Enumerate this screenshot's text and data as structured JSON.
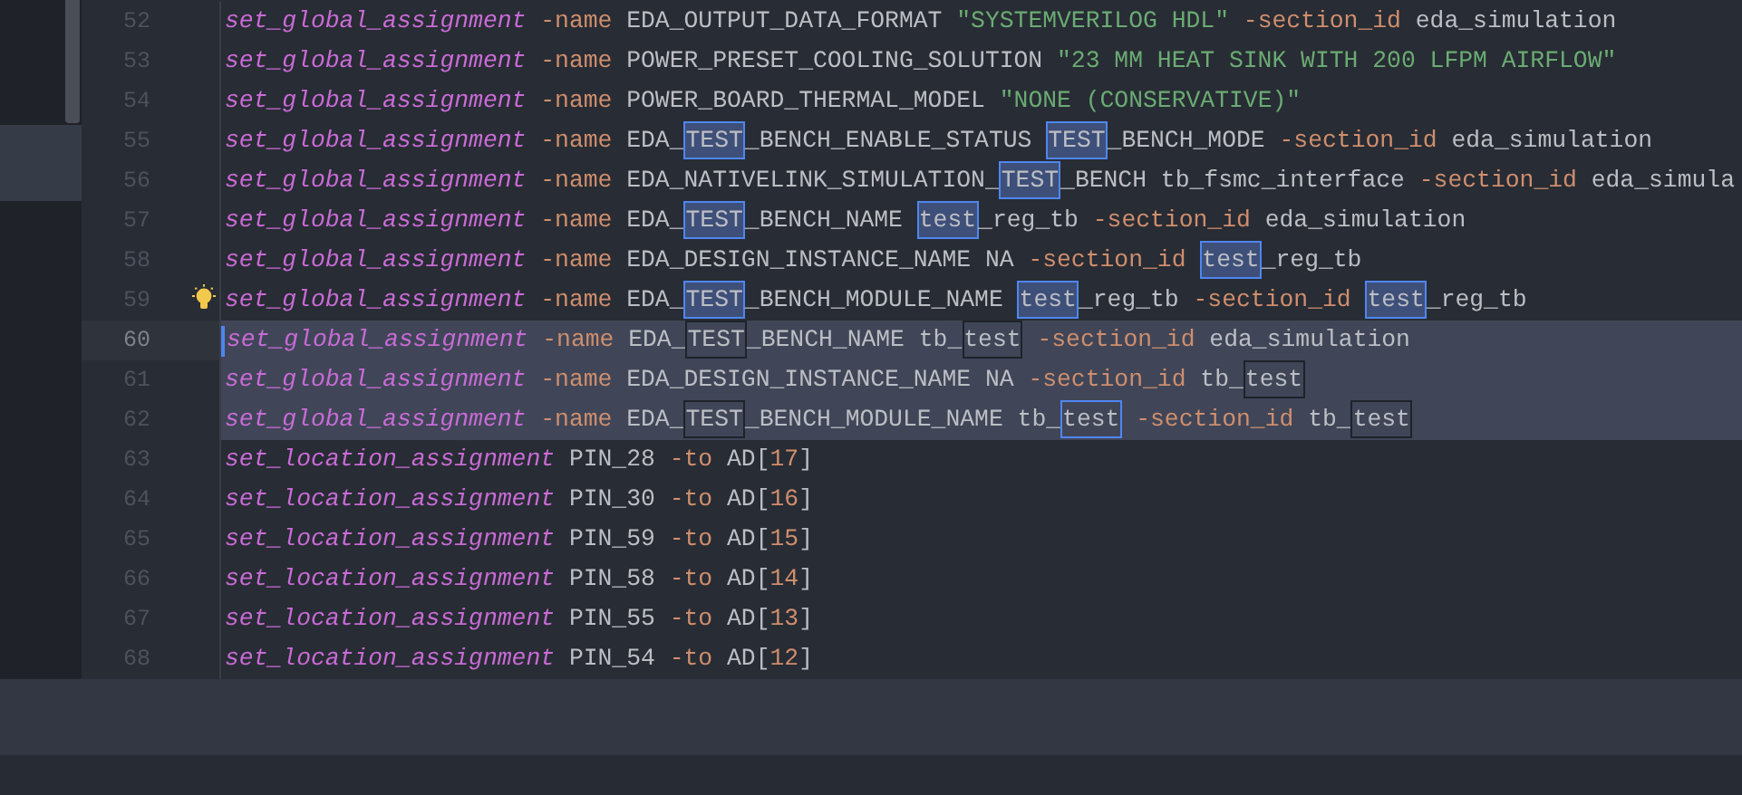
{
  "editor": {
    "lines": [
      {
        "number": "52",
        "selected": false,
        "current": false,
        "bulb": false,
        "tokens": [
          {
            "text": "set_global_assignment",
            "kind": "command"
          },
          {
            "text": " -name",
            "kind": "flag"
          },
          {
            "text": " EDA_OUTPUT_DATA_FORMAT ",
            "kind": "ident"
          },
          {
            "text": "\"SYSTEMVERILOG HDL\"",
            "kind": "string"
          },
          {
            "text": " -section_id",
            "kind": "flag"
          },
          {
            "text": " eda_simulation",
            "kind": "ident"
          }
        ]
      },
      {
        "number": "53",
        "selected": false,
        "current": false,
        "bulb": false,
        "tokens": [
          {
            "text": "set_global_assignment",
            "kind": "command"
          },
          {
            "text": " -name",
            "kind": "flag"
          },
          {
            "text": " POWER_PRESET_COOLING_SOLUTION ",
            "kind": "ident"
          },
          {
            "text": "\"23 MM HEAT SINK WITH 200 LFPM AIRFLOW\"",
            "kind": "string"
          }
        ]
      },
      {
        "number": "54",
        "selected": false,
        "current": false,
        "bulb": false,
        "tokens": [
          {
            "text": "set_global_assignment",
            "kind": "command"
          },
          {
            "text": " -name",
            "kind": "flag"
          },
          {
            "text": " POWER_BOARD_THERMAL_MODEL ",
            "kind": "ident"
          },
          {
            "text": "\"NONE (CONSERVATIVE)\"",
            "kind": "string"
          }
        ]
      },
      {
        "number": "55",
        "selected": false,
        "current": false,
        "bulb": false,
        "tokens": [
          {
            "text": "set_global_assignment",
            "kind": "command"
          },
          {
            "text": " -name",
            "kind": "flag"
          },
          {
            "text": " EDA_",
            "kind": "ident"
          },
          {
            "text": "TEST",
            "kind": "match"
          },
          {
            "text": "_BENCH_ENABLE_STATUS ",
            "kind": "ident"
          },
          {
            "text": "TEST",
            "kind": "match"
          },
          {
            "text": "_BENCH_MODE",
            "kind": "ident"
          },
          {
            "text": " -section_id",
            "kind": "flag"
          },
          {
            "text": " eda_simulation",
            "kind": "ident"
          }
        ]
      },
      {
        "number": "56",
        "selected": false,
        "current": false,
        "bulb": false,
        "tokens": [
          {
            "text": "set_global_assignment",
            "kind": "command"
          },
          {
            "text": " -name",
            "kind": "flag"
          },
          {
            "text": " EDA_NATIVELINK_SIMULATION_",
            "kind": "ident"
          },
          {
            "text": "TEST",
            "kind": "match"
          },
          {
            "text": "_BENCH tb_fsmc_interface",
            "kind": "ident"
          },
          {
            "text": " -section_id",
            "kind": "flag"
          },
          {
            "text": " eda_simula",
            "kind": "ident"
          }
        ]
      },
      {
        "number": "57",
        "selected": false,
        "current": false,
        "bulb": false,
        "tokens": [
          {
            "text": "set_global_assignment",
            "kind": "command"
          },
          {
            "text": " -name",
            "kind": "flag"
          },
          {
            "text": " EDA_",
            "kind": "ident"
          },
          {
            "text": "TEST",
            "kind": "match"
          },
          {
            "text": "_BENCH_NAME ",
            "kind": "ident"
          },
          {
            "text": "test",
            "kind": "match"
          },
          {
            "text": "_reg_tb",
            "kind": "ident"
          },
          {
            "text": " -section_id",
            "kind": "flag"
          },
          {
            "text": " eda_simulation",
            "kind": "ident"
          }
        ]
      },
      {
        "number": "58",
        "selected": false,
        "current": false,
        "bulb": false,
        "tokens": [
          {
            "text": "set_global_assignment",
            "kind": "command"
          },
          {
            "text": " -name",
            "kind": "flag"
          },
          {
            "text": " EDA_DESIGN_INSTANCE_NAME NA",
            "kind": "ident"
          },
          {
            "text": " -section_id ",
            "kind": "flag"
          },
          {
            "text": "test",
            "kind": "match"
          },
          {
            "text": "_reg_tb",
            "kind": "ident"
          }
        ]
      },
      {
        "number": "59",
        "selected": false,
        "current": false,
        "bulb": true,
        "tokens": [
          {
            "text": "set_global_assignment",
            "kind": "command"
          },
          {
            "text": " -name",
            "kind": "flag"
          },
          {
            "text": " EDA_",
            "kind": "ident"
          },
          {
            "text": "TEST",
            "kind": "match"
          },
          {
            "text": "_BENCH_MODULE_NAME ",
            "kind": "ident"
          },
          {
            "text": "test",
            "kind": "match"
          },
          {
            "text": "_reg_tb",
            "kind": "ident"
          },
          {
            "text": " -section_id ",
            "kind": "flag"
          },
          {
            "text": "test",
            "kind": "match"
          },
          {
            "text": "_reg_tb",
            "kind": "ident"
          }
        ]
      },
      {
        "number": "60",
        "selected": true,
        "current": true,
        "bulb": false,
        "tokens": [
          {
            "text": "set_global_assignment",
            "kind": "command"
          },
          {
            "text": " -name",
            "kind": "flag"
          },
          {
            "text": " EDA_",
            "kind": "ident"
          },
          {
            "text": "TEST",
            "kind": "occurrence"
          },
          {
            "text": "_BENCH_NAME tb_",
            "kind": "ident"
          },
          {
            "text": "test",
            "kind": "occurrence"
          },
          {
            "text": " -section_id",
            "kind": "flag"
          },
          {
            "text": " eda_simulation",
            "kind": "ident"
          }
        ]
      },
      {
        "number": "61",
        "selected": true,
        "current": false,
        "bulb": false,
        "tokens": [
          {
            "text": "set_global_assignment",
            "kind": "command"
          },
          {
            "text": " -name",
            "kind": "flag"
          },
          {
            "text": " EDA_DESIGN_INSTANCE_NAME NA",
            "kind": "ident"
          },
          {
            "text": " -section_id",
            "kind": "flag"
          },
          {
            "text": " tb_",
            "kind": "ident"
          },
          {
            "text": "test",
            "kind": "occurrence"
          }
        ]
      },
      {
        "number": "62",
        "selected": true,
        "current": false,
        "bulb": false,
        "tokens": [
          {
            "text": "set_global_assignment",
            "kind": "command"
          },
          {
            "text": " -name",
            "kind": "flag"
          },
          {
            "text": " EDA_",
            "kind": "ident"
          },
          {
            "text": "TEST",
            "kind": "occurrence"
          },
          {
            "text": "_BENCH_MODULE_NAME tb_",
            "kind": "ident"
          },
          {
            "text": "test",
            "kind": "focus"
          },
          {
            "text": " -section_id",
            "kind": "flag"
          },
          {
            "text": " tb_",
            "kind": "ident"
          },
          {
            "text": "test",
            "kind": "occurrence"
          }
        ]
      },
      {
        "number": "63",
        "selected": false,
        "current": false,
        "bulb": false,
        "tokens": [
          {
            "text": "set_location_assignment",
            "kind": "command"
          },
          {
            "text": " PIN_28",
            "kind": "ident"
          },
          {
            "text": " -to",
            "kind": "flag"
          },
          {
            "text": " AD",
            "kind": "ident"
          },
          {
            "text": "[",
            "kind": "punct"
          },
          {
            "text": "17",
            "kind": "number"
          },
          {
            "text": "]",
            "kind": "punct"
          }
        ]
      },
      {
        "number": "64",
        "selected": false,
        "current": false,
        "bulb": false,
        "tokens": [
          {
            "text": "set_location_assignment",
            "kind": "command"
          },
          {
            "text": " PIN_30",
            "kind": "ident"
          },
          {
            "text": " -to",
            "kind": "flag"
          },
          {
            "text": " AD",
            "kind": "ident"
          },
          {
            "text": "[",
            "kind": "punct"
          },
          {
            "text": "16",
            "kind": "number"
          },
          {
            "text": "]",
            "kind": "punct"
          }
        ]
      },
      {
        "number": "65",
        "selected": false,
        "current": false,
        "bulb": false,
        "tokens": [
          {
            "text": "set_location_assignment",
            "kind": "command"
          },
          {
            "text": " PIN_59",
            "kind": "ident"
          },
          {
            "text": " -to",
            "kind": "flag"
          },
          {
            "text": " AD",
            "kind": "ident"
          },
          {
            "text": "[",
            "kind": "punct"
          },
          {
            "text": "15",
            "kind": "number"
          },
          {
            "text": "]",
            "kind": "punct"
          }
        ]
      },
      {
        "number": "66",
        "selected": false,
        "current": false,
        "bulb": false,
        "tokens": [
          {
            "text": "set_location_assignment",
            "kind": "command"
          },
          {
            "text": " PIN_58",
            "kind": "ident"
          },
          {
            "text": " -to",
            "kind": "flag"
          },
          {
            "text": " AD",
            "kind": "ident"
          },
          {
            "text": "[",
            "kind": "punct"
          },
          {
            "text": "14",
            "kind": "number"
          },
          {
            "text": "]",
            "kind": "punct"
          }
        ]
      },
      {
        "number": "67",
        "selected": false,
        "current": false,
        "bulb": false,
        "tokens": [
          {
            "text": "set_location_assignment",
            "kind": "command"
          },
          {
            "text": " PIN_55",
            "kind": "ident"
          },
          {
            "text": " -to",
            "kind": "flag"
          },
          {
            "text": " AD",
            "kind": "ident"
          },
          {
            "text": "[",
            "kind": "punct"
          },
          {
            "text": "13",
            "kind": "number"
          },
          {
            "text": "]",
            "kind": "punct"
          }
        ]
      },
      {
        "number": "68",
        "selected": false,
        "current": false,
        "bulb": false,
        "tokens": [
          {
            "text": "set_location_assignment",
            "kind": "command"
          },
          {
            "text": " PIN_54",
            "kind": "ident"
          },
          {
            "text": " -to",
            "kind": "flag"
          },
          {
            "text": " AD",
            "kind": "ident"
          },
          {
            "text": "[",
            "kind": "punct"
          },
          {
            "text": "12",
            "kind": "number"
          },
          {
            "text": "]",
            "kind": "punct"
          }
        ]
      }
    ]
  }
}
